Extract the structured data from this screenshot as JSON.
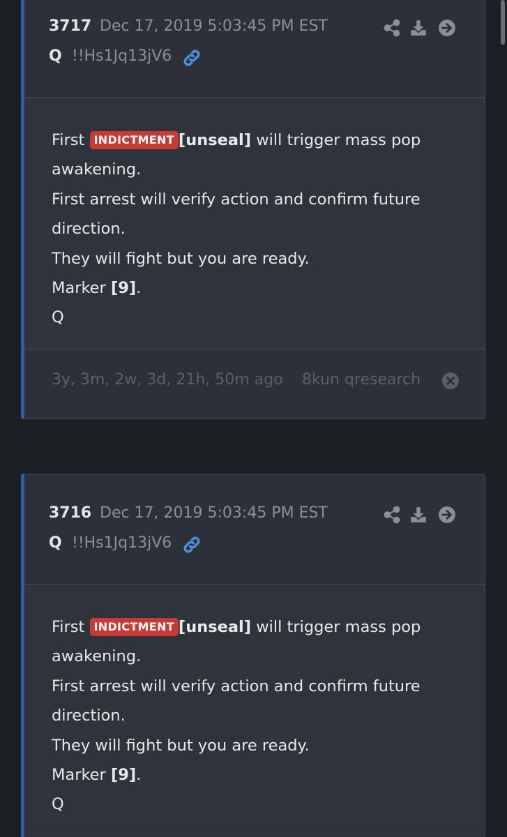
{
  "posts": [
    {
      "number": "3717",
      "date": "Dec 17, 2019 5:03:45 PM EST",
      "author": "Q",
      "tripcode": "!!Hs1Jq13jV6",
      "line1_pre": "First",
      "badge": "INDICTMENT",
      "line1_bold": "[unseal]",
      "line1_post": "will trigger mass pop awakening.",
      "line2": "First arrest will verify action and confirm future direction.",
      "line3": "They will fight but you are ready.",
      "line4_pre": "Marker",
      "line4_bold": "[9]",
      "line4_post": ".",
      "signature": "Q",
      "ago": "3y, 3m, 2w, 3d, 21h, 50m ago",
      "source": "8kun qresearch"
    },
    {
      "number": "3716",
      "date": "Dec 17, 2019 5:03:45 PM EST",
      "author": "Q",
      "tripcode": "!!Hs1Jq13jV6",
      "line1_pre": "First",
      "badge": "INDICTMENT",
      "line1_bold": "[unseal]",
      "line1_post": "will trigger mass pop awakening.",
      "line2": "First arrest will verify action and confirm future direction.",
      "line3": "They will fight but you are ready.",
      "line4_pre": "Marker",
      "line4_bold": "[9]",
      "line4_post": ".",
      "signature": "Q"
    }
  ],
  "icons": {
    "share": "share-icon",
    "download": "download-icon",
    "go": "arrow-right-circle-icon",
    "link": "link-icon",
    "close": "close-circle-icon"
  },
  "colors": {
    "accent_bar": "#2f5da8",
    "badge": "#c83a33",
    "link": "#4a90e2",
    "card_bg": "#2d3137",
    "page_bg": "#1c1f23"
  }
}
